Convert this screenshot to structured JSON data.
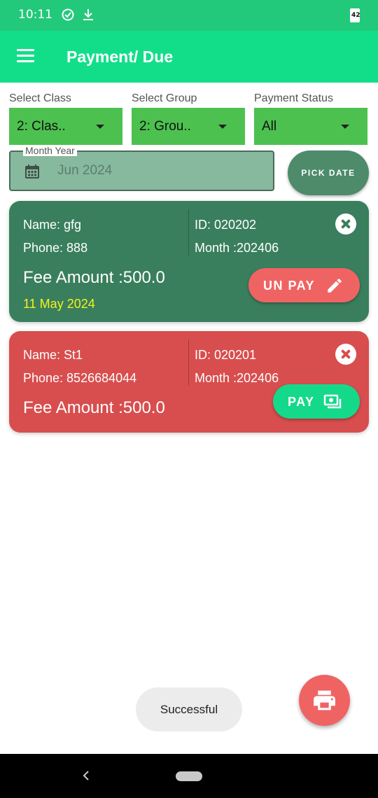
{
  "status_bar": {
    "time": "10:11",
    "battery": "42"
  },
  "app_bar": {
    "title": "Payment/ Due"
  },
  "filters": [
    {
      "label": "Select Class",
      "value": "2: Clas.."
    },
    {
      "label": "Select Group",
      "value": "2: Grou.."
    },
    {
      "label": "Payment Status",
      "value": "All"
    }
  ],
  "month_year": {
    "label": "Month Year",
    "value": "Jun 2024"
  },
  "pick_date_label": "PICK DATE",
  "cards": [
    {
      "name": "Name: gfg",
      "phone": "Phone: 888",
      "id": "ID: 020202",
      "month": "Month :202406",
      "fee": "Fee Amount :500.0",
      "date": "11 May 2024",
      "action_label": "UN PAY",
      "color": "#3a7f5d"
    },
    {
      "name": "Name: St1",
      "phone": "Phone: 8526684044",
      "id": "ID: 020201",
      "month": "Month :202406",
      "fee": "Fee Amount :500.0",
      "action_label": "PAY",
      "color": "#d84e4e"
    }
  ],
  "toast": "Successful",
  "colors": {
    "status_bar": "#22c97a",
    "app_bar": "#12de8a",
    "dropdown": "#4cc14f",
    "unpay_button": "#f06363",
    "pay_button": "#14d98a",
    "fab": "#f06363"
  }
}
